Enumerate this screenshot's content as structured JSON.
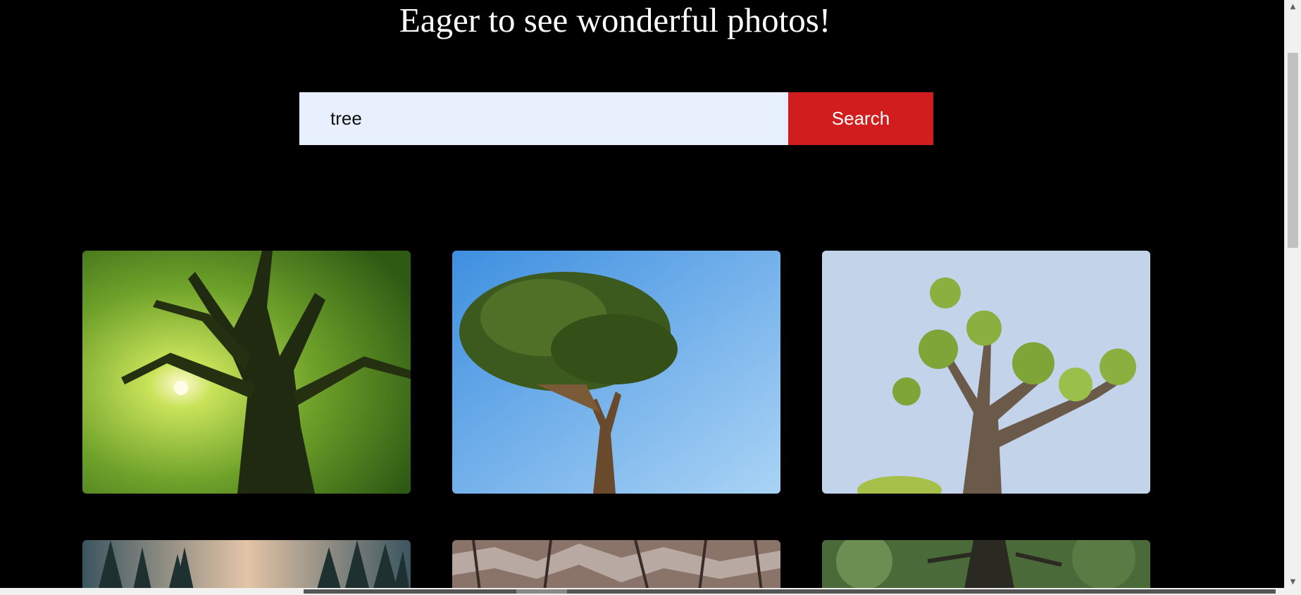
{
  "page": {
    "title": "Eager to see wonderful photos!"
  },
  "search": {
    "value": "tree",
    "button_label": "Search"
  },
  "colors": {
    "background": "#000000",
    "input_bg": "#e8f0fe",
    "button_bg": "#d11d1d"
  },
  "gallery": {
    "photos": [
      {
        "subject": "tree canopy with sunlight"
      },
      {
        "subject": "umbrella pine against blue sky"
      },
      {
        "subject": "old tree branches with leaves"
      },
      {
        "subject": "forest with pine trees"
      },
      {
        "subject": "tree bark closeup"
      },
      {
        "subject": "green tree trunk"
      }
    ]
  }
}
